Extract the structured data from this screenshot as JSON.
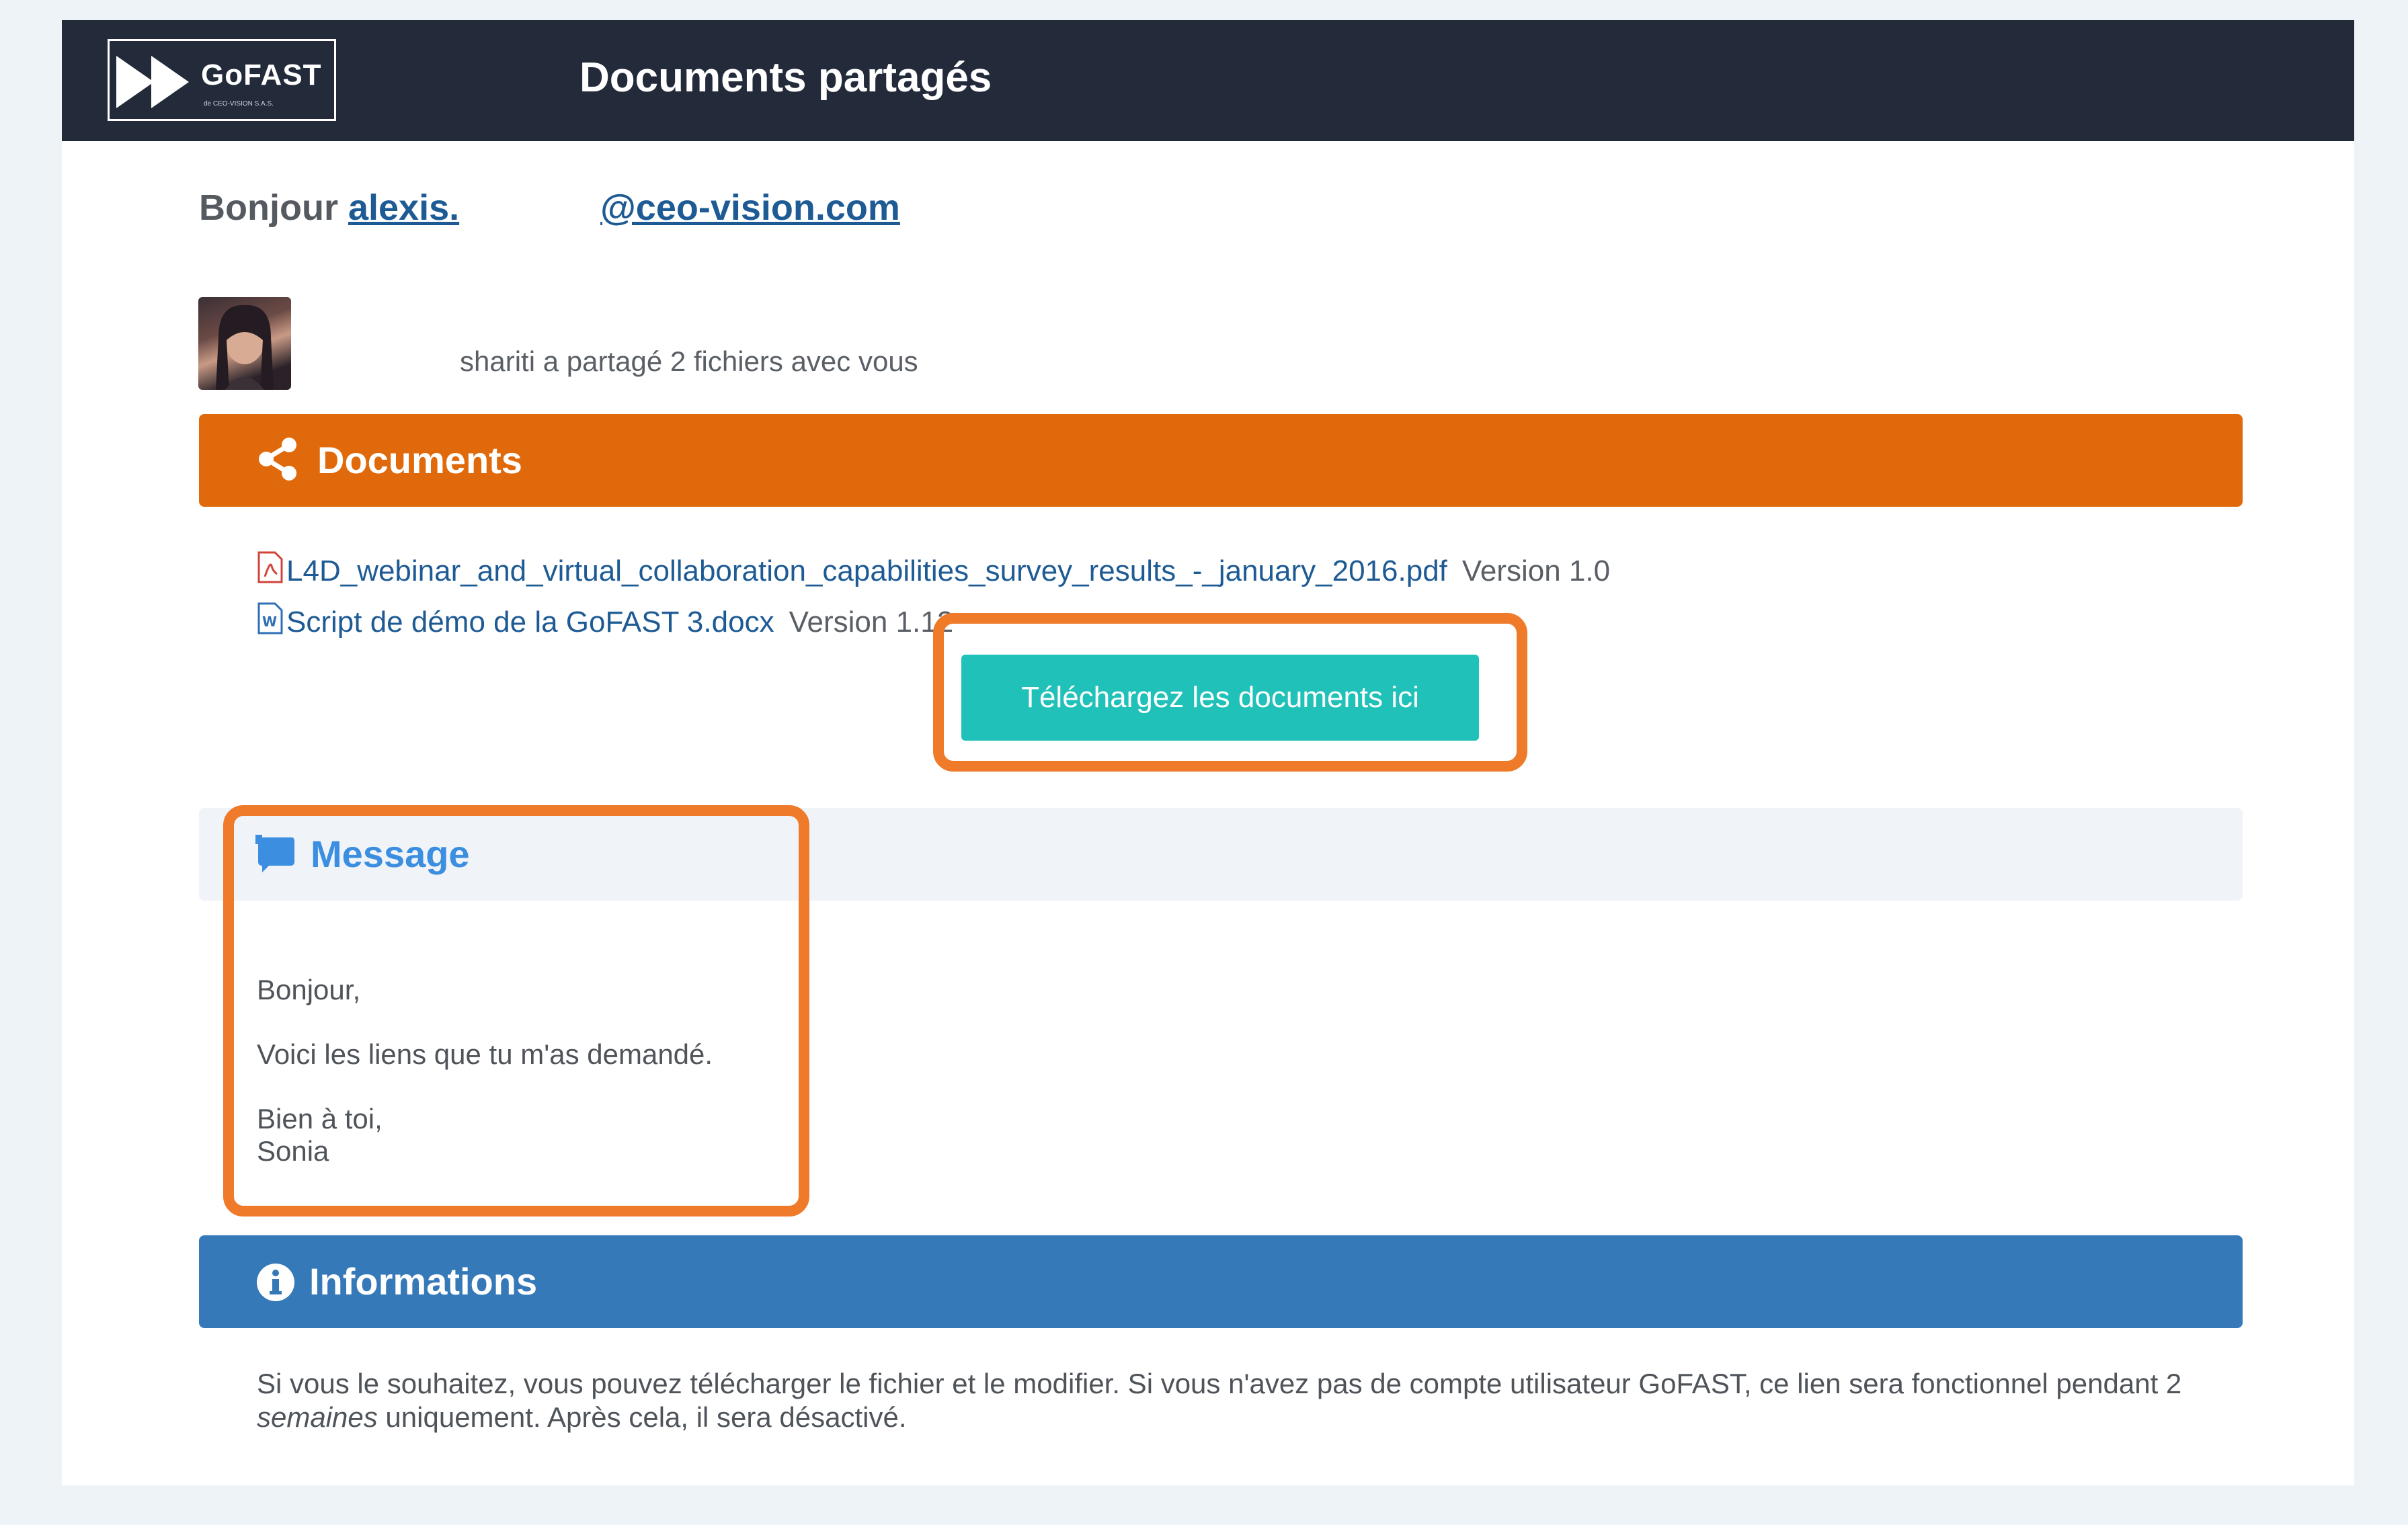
{
  "header": {
    "logo_text": "GoFAST",
    "logo_sub": "de CEO-VISION S.A.S.",
    "title": "Documents partagés"
  },
  "greeting": {
    "prefix": "Bonjour",
    "email_start": "alexis.",
    "email_end": "@ceo-vision.com"
  },
  "share": {
    "text": "shariti a partagé 2 fichiers avec vous"
  },
  "documents": {
    "heading": "Documents",
    "icon": "share-icon",
    "files": [
      {
        "name": "L4D_webinar_and_virtual_collaboration_capabilities_survey_results_-_january_2016.pdf",
        "version": "Version 1.0",
        "icon": "pdf-file-icon"
      },
      {
        "name": "Script de démo de la GoFAST 3.docx",
        "version": "Version 1.12",
        "icon": "word-file-icon"
      }
    ],
    "download_label": "Téléchargez les documents ici"
  },
  "message": {
    "heading": "Message",
    "icon": "message-icon",
    "lines": [
      "Bonjour,",
      "Voici les liens que tu m'as demandé.",
      "Bien à toi,",
      "Sonia"
    ]
  },
  "informations": {
    "heading": "Informations",
    "icon": "info-icon",
    "text_part1": "Si vous le souhaitez, vous pouvez télécharger le fichier et le modifier. Si vous n'avez pas de compte utilisateur GoFAST, ce lien sera fonctionnel pendant 2 ",
    "text_em": "semaines",
    "text_part2": " uniquement. Après cela, il sera désactivé."
  },
  "colors": {
    "topbar": "#232a3a",
    "documents_header": "#e06a0b",
    "informations_header": "#3579b8",
    "download_button": "#1fc1b8",
    "highlight": "#ef7a2a",
    "link": "#1e5b94"
  }
}
